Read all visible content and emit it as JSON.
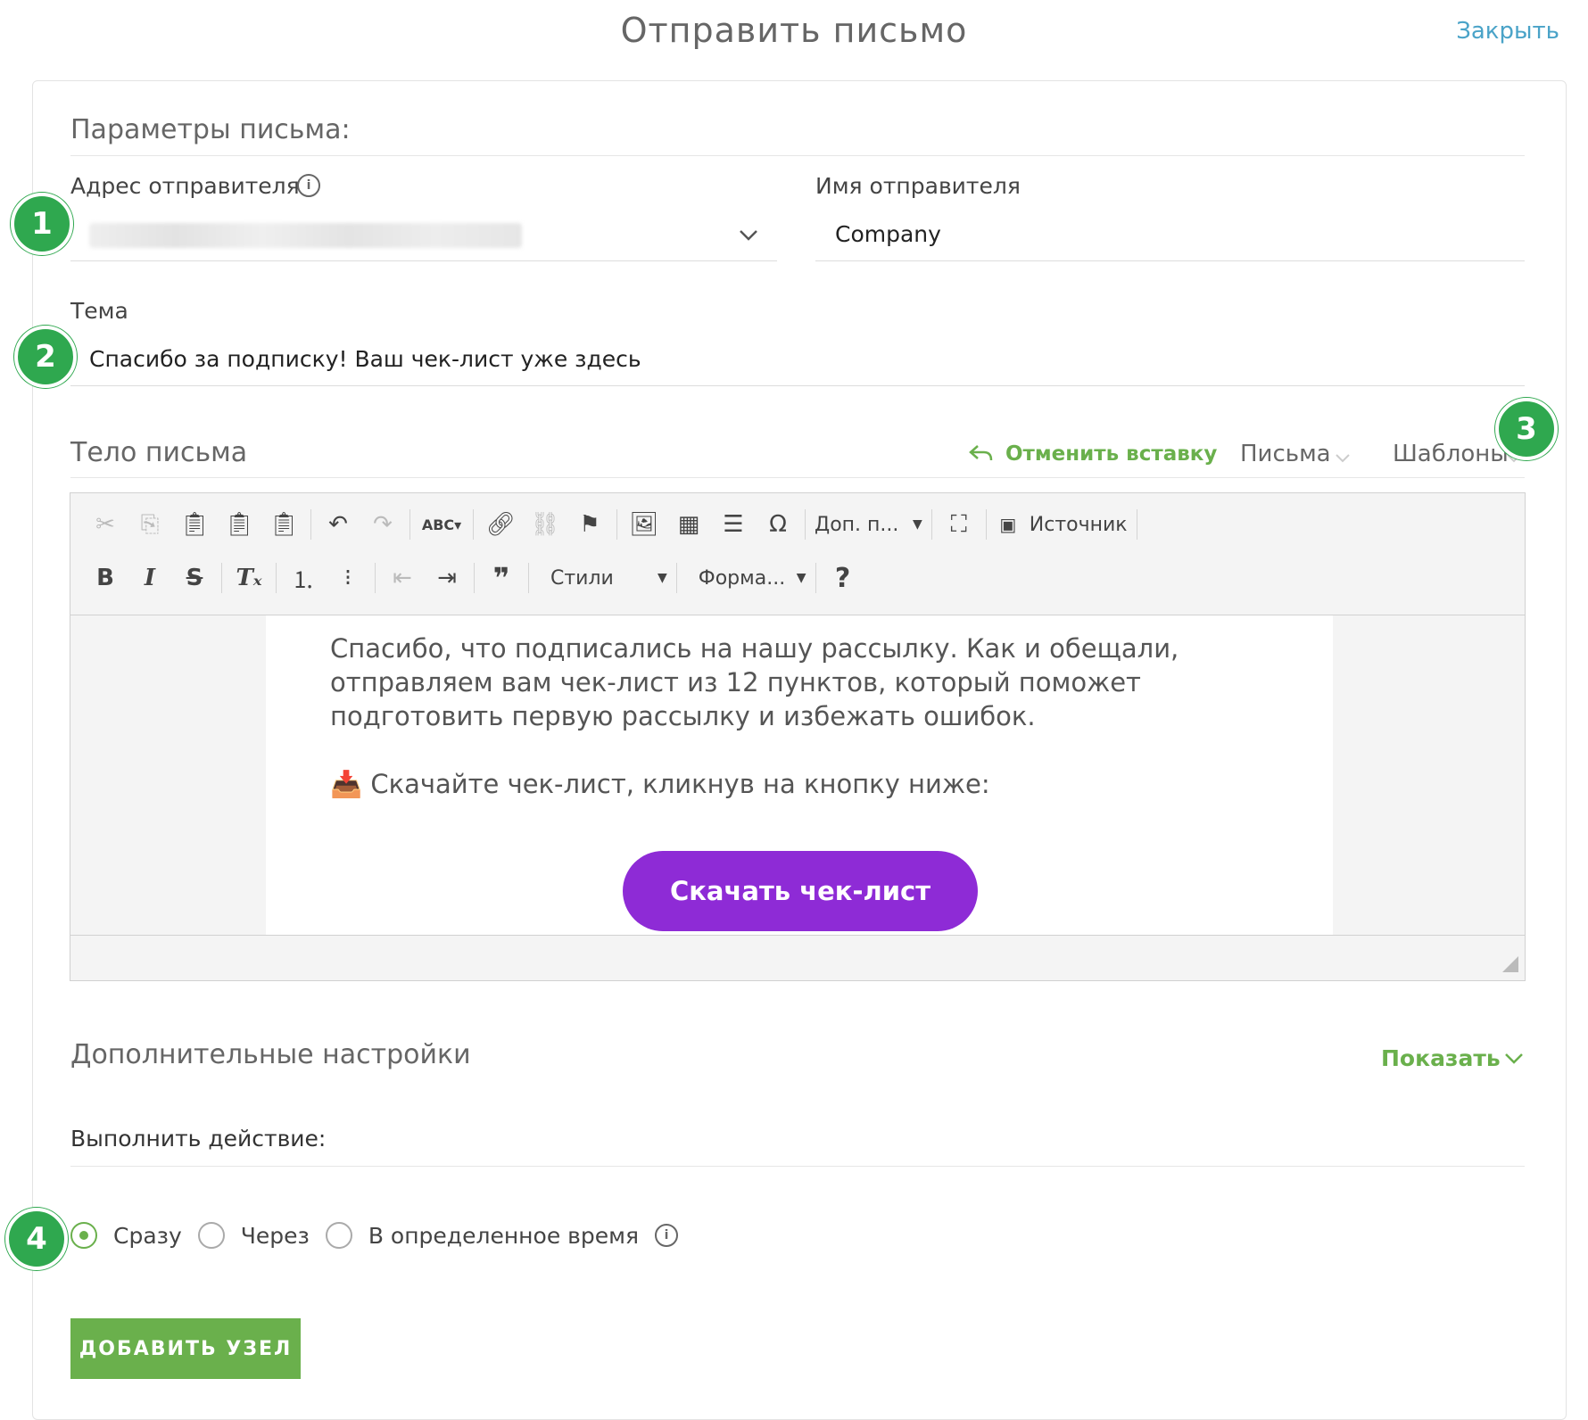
{
  "header": {
    "title": "Отправить письмо",
    "close_label": "Закрыть"
  },
  "params": {
    "section_title": "Параметры письма:",
    "sender_address_label": "Адрес отправителя",
    "sender_name_label": "Имя отправителя",
    "sender_name_value": "Company",
    "subject_label": "Тема",
    "subject_value": "Спасибо за подписку! Ваш чек-лист уже здесь"
  },
  "body": {
    "section_title": "Тело письма",
    "undo_paste": "Отменить вставку",
    "letters_label": "Письма",
    "templates_label": "Шаблоны"
  },
  "toolbar": {
    "more_label": "Доп. п...",
    "source_label": "Источник",
    "styles_label": "Стили",
    "format_label": "Форма...",
    "help_label": "?"
  },
  "email_content": {
    "paragraph": "Спасибо, что подписались на нашу рассылку. Как и обещали, отправляем вам чек-лист из 12 пунктов, который поможет подготовить первую рассылку и избежать ошибок.",
    "download_line": "📥 Скачайте чек-лист, кликнув на кнопку ниже:",
    "button_label": "Скачать чек-лист"
  },
  "extra": {
    "section_title": "Дополнительные настройки",
    "show_label": "Показать",
    "action_label": "Выполнить действие:",
    "options": [
      {
        "label": "Сразу",
        "selected": true
      },
      {
        "label": "Через",
        "selected": false
      },
      {
        "label": "В определенное время",
        "selected": false
      }
    ],
    "add_node_label": "ДОБАВИТЬ УЗЕЛ"
  },
  "badges": [
    "1",
    "2",
    "3",
    "4"
  ],
  "colors": {
    "accent_green": "#6ab04c",
    "badge_green": "#2fa84f",
    "button_purple": "#8e2bd6",
    "link_blue": "#4aa3c8"
  }
}
